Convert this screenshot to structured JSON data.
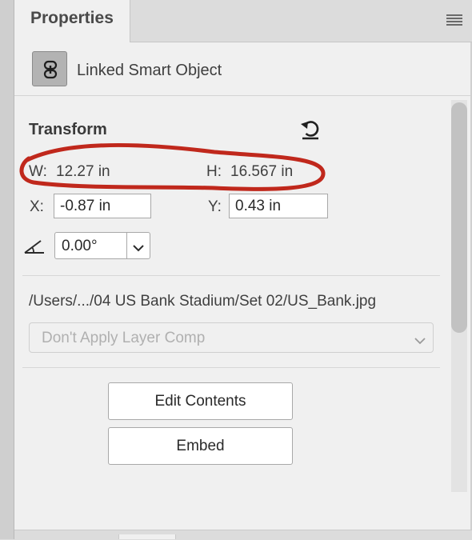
{
  "panel": {
    "tab_title": "Properties",
    "menu_icon": "hamburger-menu-icon"
  },
  "header": {
    "icon": "linked-smart-object-icon",
    "label": "Linked Smart Object"
  },
  "transform": {
    "title": "Transform",
    "reset_icon": "reset-transform-icon",
    "w_label": "W:",
    "w_value": "12.27 in",
    "h_label": "H:",
    "h_value": "16.567 in",
    "x_label": "X:",
    "x_value": "-0.87 in",
    "y_label": "Y:",
    "y_value": "0.43 in",
    "angle_icon": "angle-icon",
    "angle_value": "0.00°"
  },
  "source": {
    "path": "/Users/.../04 US Bank Stadium/Set 02/US_Bank.jpg",
    "layer_comp_selected": "Don't Apply Layer Comp"
  },
  "actions": {
    "edit_contents_label": "Edit Contents",
    "embed_label": "Embed"
  },
  "colors": {
    "annotation": "#c0281c",
    "panel_bg": "#f0f0f0"
  }
}
